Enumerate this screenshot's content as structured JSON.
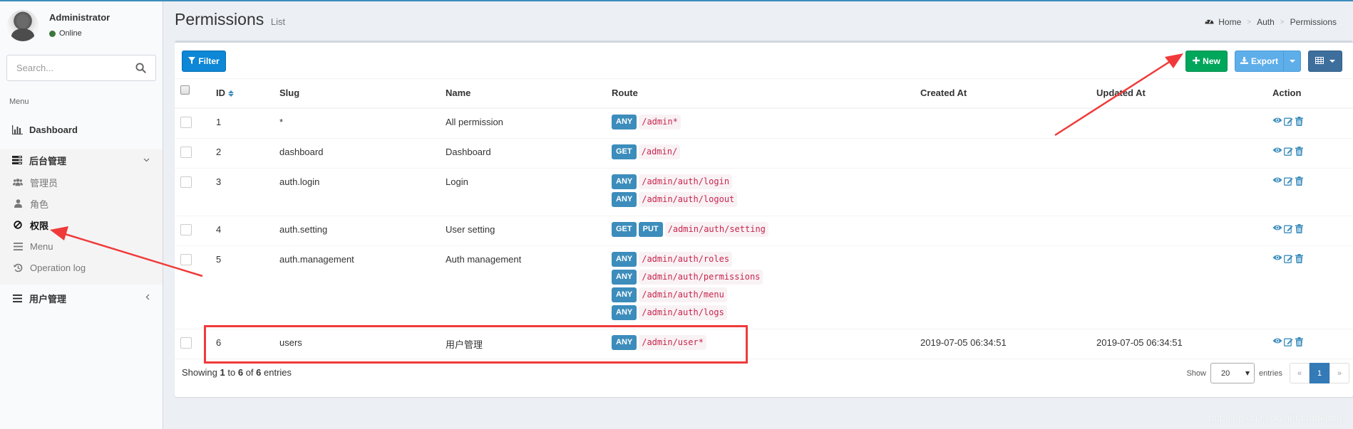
{
  "sidebar": {
    "user": {
      "name": "Administrator",
      "status": "Online"
    },
    "search": {
      "placeholder": "Search..."
    },
    "menu_header": "Menu",
    "items": [
      {
        "label": "Dashboard",
        "icon": "bar-chart-icon"
      },
      {
        "label": "后台管理",
        "icon": "tasks-icon",
        "expanded": true,
        "children": [
          {
            "label": "管理员",
            "icon": "users-icon"
          },
          {
            "label": "角色",
            "icon": "user-icon"
          },
          {
            "label": "权限",
            "icon": "ban-icon",
            "active": true
          },
          {
            "label": "Menu",
            "icon": "bars-icon"
          },
          {
            "label": "Operation log",
            "icon": "history-icon"
          }
        ]
      },
      {
        "label": "用户管理",
        "icon": "bars-icon",
        "expanded": false
      }
    ]
  },
  "header": {
    "title": "Permissions",
    "subtitle": "List",
    "breadcrumb": [
      "Home",
      "Auth",
      "Permissions"
    ]
  },
  "toolbar": {
    "filter_label": "Filter",
    "new_label": "New",
    "export_label": "Export"
  },
  "table": {
    "columns": [
      "ID",
      "Slug",
      "Name",
      "Route",
      "Created At",
      "Updated At",
      "Action"
    ],
    "rows": [
      {
        "id": "1",
        "slug": "*",
        "name": "All permission",
        "routes": [
          {
            "methods": [
              "ANY"
            ],
            "path": "/admin*"
          }
        ],
        "created_at": "",
        "updated_at": ""
      },
      {
        "id": "2",
        "slug": "dashboard",
        "name": "Dashboard",
        "routes": [
          {
            "methods": [
              "GET"
            ],
            "path": "/admin/"
          }
        ],
        "created_at": "",
        "updated_at": ""
      },
      {
        "id": "3",
        "slug": "auth.login",
        "name": "Login",
        "routes": [
          {
            "methods": [
              "ANY"
            ],
            "path": "/admin/auth/login"
          },
          {
            "methods": [
              "ANY"
            ],
            "path": "/admin/auth/logout"
          }
        ],
        "created_at": "",
        "updated_at": ""
      },
      {
        "id": "4",
        "slug": "auth.setting",
        "name": "User setting",
        "routes": [
          {
            "methods": [
              "GET",
              "PUT"
            ],
            "path": "/admin/auth/setting"
          }
        ],
        "created_at": "",
        "updated_at": ""
      },
      {
        "id": "5",
        "slug": "auth.management",
        "name": "Auth management",
        "routes": [
          {
            "methods": [
              "ANY"
            ],
            "path": "/admin/auth/roles"
          },
          {
            "methods": [
              "ANY"
            ],
            "path": "/admin/auth/permissions"
          },
          {
            "methods": [
              "ANY"
            ],
            "path": "/admin/auth/menu"
          },
          {
            "methods": [
              "ANY"
            ],
            "path": "/admin/auth/logs"
          }
        ],
        "created_at": "",
        "updated_at": ""
      },
      {
        "id": "6",
        "slug": "users",
        "name": "用户管理",
        "routes": [
          {
            "methods": [
              "ANY"
            ],
            "path": "/admin/user*"
          }
        ],
        "created_at": "2019-07-05 06:34:51",
        "updated_at": "2019-07-05 06:34:51"
      }
    ]
  },
  "footer": {
    "showing_prefix": "Showing",
    "from": "1",
    "to_word": "to",
    "to": "6",
    "of_word": "of",
    "total": "6",
    "entries_word": "entries",
    "show_label": "Show",
    "per_page": "20",
    "entries_label": "entries",
    "prev": "«",
    "current_page": "1",
    "next": "»"
  },
  "watermark": "https://blog.csdn.net/fangkang7",
  "colors": {
    "primary": "#3c8dbc",
    "success": "#00a65a",
    "filter": "#0d87d6",
    "export": "#5eaeea",
    "columns": "#3e6f9c",
    "code": "#c7254e",
    "annotation": "#f03a3a"
  }
}
